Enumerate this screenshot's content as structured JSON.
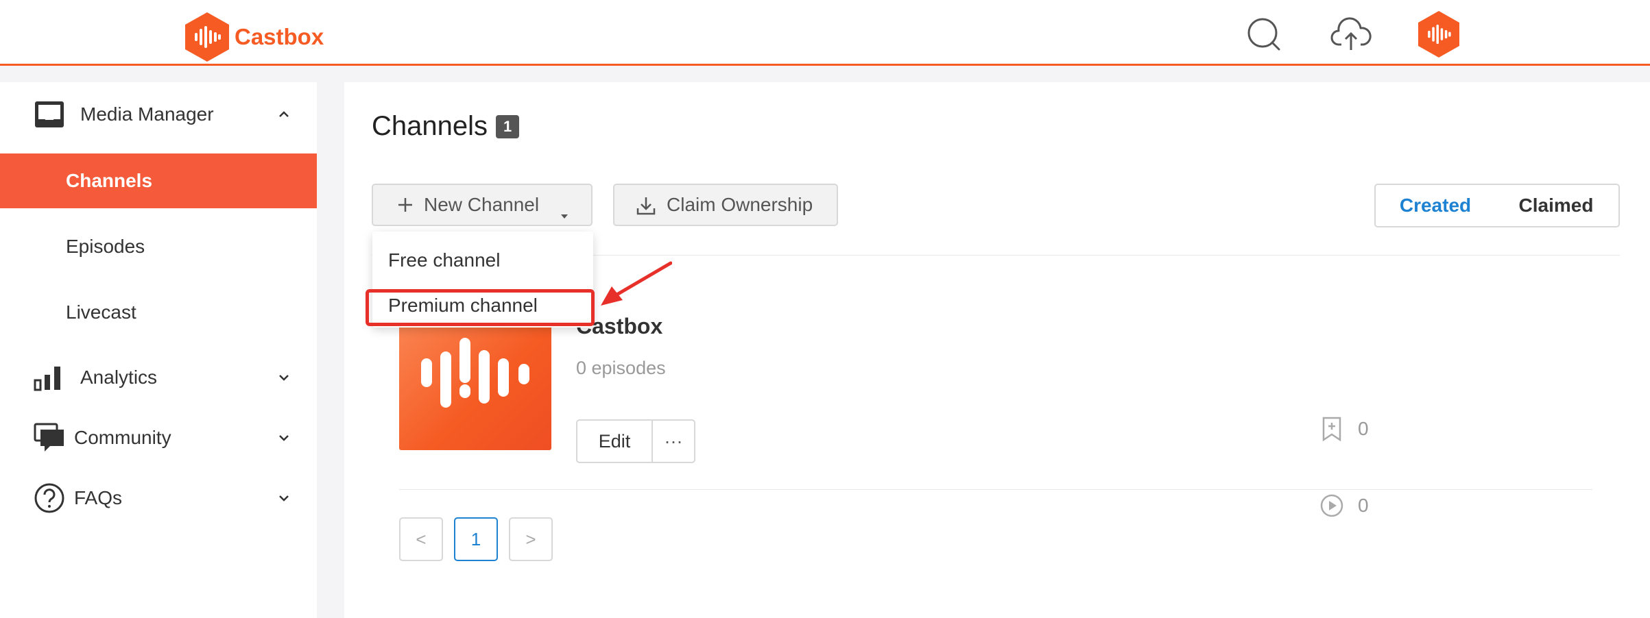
{
  "app": {
    "name": "Castbox",
    "brand_color": "#f55b23",
    "accent_color": "#1e82d2"
  },
  "header": {
    "icons": [
      "search-icon",
      "upload-cloud-icon",
      "avatar-castbox-icon"
    ]
  },
  "sidebar": {
    "media_manager": {
      "label": "Media Manager",
      "icon": "inbox-tray-icon",
      "expanded": true,
      "items": [
        {
          "label": "Channels",
          "active": true
        },
        {
          "label": "Episodes",
          "active": false
        },
        {
          "label": "Livecast",
          "active": false
        }
      ]
    },
    "analytics": {
      "label": "Analytics",
      "icon": "bar-chart-icon"
    },
    "community": {
      "label": "Community",
      "icon": "chat-bubbles-icon"
    },
    "faqs": {
      "label": "FAQs",
      "icon": "question-circle-icon"
    }
  },
  "main": {
    "title": "Channels",
    "count": "1",
    "new_channel_label": "New Channel",
    "claim_label": "Claim Ownership",
    "filter": {
      "created": "Created",
      "claimed": "Claimed",
      "selected": "Created"
    },
    "dropdown": {
      "free": "Free channel",
      "premium": "Premium channel"
    },
    "channel": {
      "name": "Castbox",
      "episodes": "0 episodes",
      "edit_label": "Edit",
      "more_label": "···",
      "subscribers": "0",
      "plays": "0"
    },
    "pagination": {
      "prev": "<",
      "page": "1",
      "next": ">"
    }
  }
}
